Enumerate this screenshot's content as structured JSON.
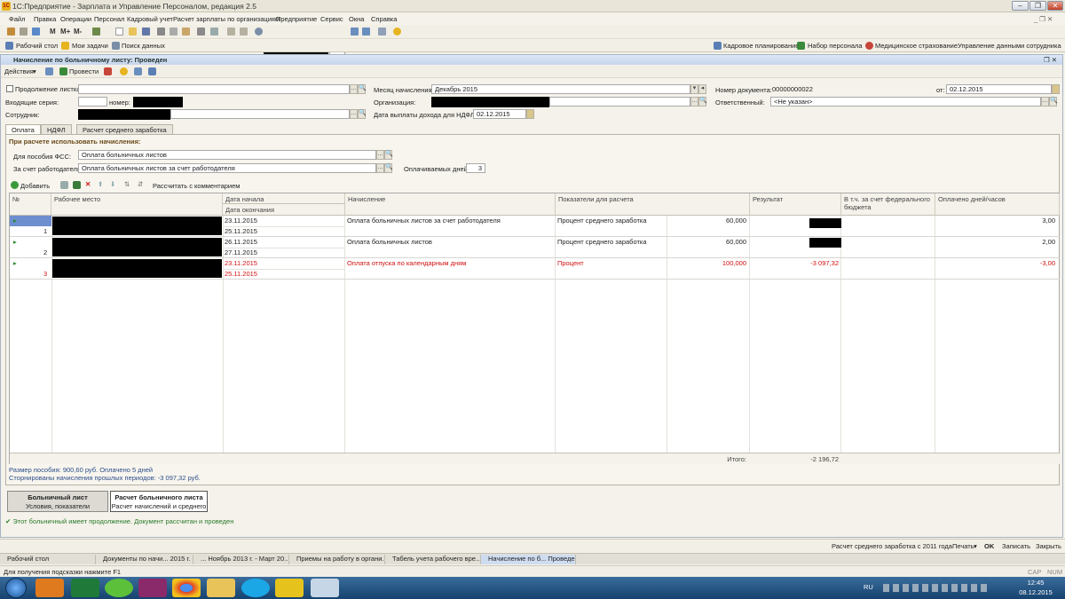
{
  "app": {
    "title": "1С:Предприятие - Зарплата и Управление Персоналом, редакция 2.5",
    "menu": [
      "Файл",
      "Правка",
      "Операции",
      "Персонал",
      "Кадровый учет",
      "Расчет зарплаты по организациям",
      "Предприятие",
      "Сервис",
      "Окна",
      "Справка"
    ]
  },
  "toolbar1": {
    "m_label": "M",
    "mplus_label": "M+",
    "mminus_label": "M-"
  },
  "toolbar2": {
    "left": [
      "Рабочий стол",
      "Мои задачи",
      "Поиск данных"
    ],
    "right": [
      "Кадровое планирование",
      "Набор персонала",
      "Медицинское страхование",
      "Управление данными сотрудника"
    ]
  },
  "document": {
    "title": "Начисление по больничному листу: Проведен",
    "actions_label": "Действия",
    "post_label": "Провести",
    "continuation_label": "Продолжение листка",
    "incoming_series_label": "Входящие серия:",
    "number_label": "номер:",
    "employee_label": "Сотрудник:",
    "month_label": "Месяц начисления:",
    "month_value": "Декабрь 2015",
    "org_label": "Организация:",
    "ndfl_date_label": "Дата выплаты дохода для НДФЛ:",
    "ndfl_date_value": "02.12.2015",
    "doc_number_label": "Номер документа:",
    "doc_number_value": "00000000022",
    "from_label": "от:",
    "from_value": "02.12.2015",
    "responsible_label": "Ответственный:",
    "responsible_value": "<Не указан>"
  },
  "tabs": [
    "Оплата",
    "НДФЛ",
    "Расчет среднего заработка"
  ],
  "payment": {
    "section_title": "При расчете использовать начисления:",
    "fss_label": "Для пособия ФСС:",
    "fss_value": "Оплата больничных листов",
    "employer_label": "За счет работодателя:",
    "employer_value": "Оплата больничных листов за счет работодателя",
    "paid_days_label": "Оплачиваемых дней:",
    "paid_days_value": "3",
    "add_label": "Добавить",
    "calc_with_comment": "Рассчитать с комментарием"
  },
  "grid": {
    "headers": {
      "num": "№",
      "workplace": "Рабочее место",
      "date_start": "Дата начала",
      "date_end": "Дата окончания",
      "accrual": "Начисление",
      "indicators": "Показатели для расчета",
      "result": "Результат",
      "federal": "В т.ч. за счет федерального бюджета",
      "paid_days": "Оплачено дней/часов"
    },
    "rows": [
      {
        "n": "1",
        "start": "23.11.2015",
        "end": "25.11.2015",
        "accrual": "Оплата больничных листов за счет работодателя",
        "indicator": "Процент среднего заработка",
        "value": "60,000",
        "result": "",
        "days": "3,00",
        "red": false
      },
      {
        "n": "2",
        "start": "26.11.2015",
        "end": "27.11.2015",
        "accrual": "Оплата больничных листов",
        "indicator": "Процент среднего заработка",
        "value": "60,000",
        "result": "",
        "days": "2,00",
        "red": false
      },
      {
        "n": "3",
        "start": "23.11.2015",
        "end": "25.11.2015",
        "accrual": "Оплата отпуска по календарным дням",
        "indicator": "Процент",
        "value": "100,000",
        "result": "-3 097,32",
        "days": "-3,00",
        "red": true
      }
    ],
    "total_label": "Итого:",
    "total_value": "-2 196,72"
  },
  "footer": {
    "benefit_line": "Размер пособия: 900,60 руб. Оплачено 5 дней",
    "reversed_line": "Сторнированы начисления прошлых периодов: -3 097,32 руб.",
    "tab1_title": "Больничный лист",
    "tab1_sub": "Условия, показатели",
    "tab2_title": "Расчет больничного листа",
    "tab2_sub": "Расчет начислений и среднего",
    "status": "Этот больничный имеет продолжение. Документ рассчитан и проведен"
  },
  "bottombar": {
    "calc_label": "Расчет среднего заработка с 2011 года",
    "print_label": "Печать",
    "ok_label": "OK",
    "save_label": "Записать",
    "close_label": "Закрыть"
  },
  "window_tabs": [
    "Рабочий стол",
    "Документы по начи... 2015 г.",
    "... Ноябрь 2013 г. - Март 20...",
    "Приемы на работу в органи...",
    "Табель учета рабочего вре...",
    "Начисление по б... Проведен"
  ],
  "hint": {
    "text": "Для получения подсказки нажмите F1",
    "cap": "CAP",
    "num": "NUM"
  },
  "taskbar": {
    "lang": "RU",
    "time": "12:45",
    "date": "08.12.2015"
  },
  "colors": {
    "accent": "#2d4e8a",
    "red": "#d01010",
    "green": "#2a7a2a",
    "taskbar": "#16426e"
  }
}
